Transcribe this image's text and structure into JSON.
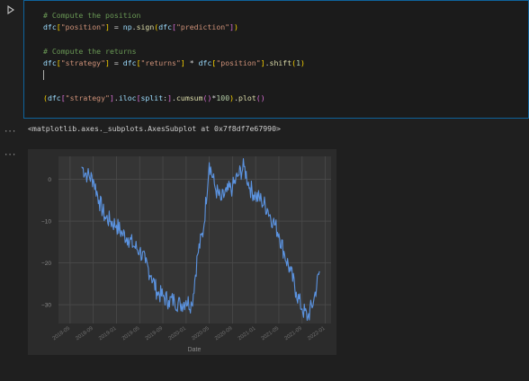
{
  "cell": {
    "code_lines": [
      [
        {
          "t": "# Compute the position",
          "c": "tok-comment"
        }
      ],
      [
        {
          "t": "dfc",
          "c": "tok-var"
        },
        {
          "t": "[",
          "c": "tok-br1"
        },
        {
          "t": "\"position\"",
          "c": "tok-str"
        },
        {
          "t": "]",
          "c": "tok-br1"
        },
        {
          "t": " = ",
          "c": "tok-op"
        },
        {
          "t": "np",
          "c": "tok-var"
        },
        {
          "t": ".",
          "c": "tok-op"
        },
        {
          "t": "sign",
          "c": "tok-fn"
        },
        {
          "t": "(",
          "c": "tok-br1"
        },
        {
          "t": "dfc",
          "c": "tok-var"
        },
        {
          "t": "[",
          "c": "tok-br2"
        },
        {
          "t": "\"prediction\"",
          "c": "tok-str"
        },
        {
          "t": "]",
          "c": "tok-br2"
        },
        {
          "t": ")",
          "c": "tok-br1"
        }
      ],
      [],
      [
        {
          "t": "# Compute the returns",
          "c": "tok-comment"
        }
      ],
      [
        {
          "t": "dfc",
          "c": "tok-var"
        },
        {
          "t": "[",
          "c": "tok-br1"
        },
        {
          "t": "\"strategy\"",
          "c": "tok-str"
        },
        {
          "t": "]",
          "c": "tok-br1"
        },
        {
          "t": " = ",
          "c": "tok-op"
        },
        {
          "t": "dfc",
          "c": "tok-var"
        },
        {
          "t": "[",
          "c": "tok-br1"
        },
        {
          "t": "\"returns\"",
          "c": "tok-str"
        },
        {
          "t": "]",
          "c": "tok-br1"
        },
        {
          "t": " * ",
          "c": "tok-op"
        },
        {
          "t": "dfc",
          "c": "tok-var"
        },
        {
          "t": "[",
          "c": "tok-br1"
        },
        {
          "t": "\"position\"",
          "c": "tok-str"
        },
        {
          "t": "]",
          "c": "tok-br1"
        },
        {
          "t": ".",
          "c": "tok-op"
        },
        {
          "t": "shift",
          "c": "tok-fn"
        },
        {
          "t": "(",
          "c": "tok-br1"
        },
        {
          "t": "1",
          "c": "tok-num"
        },
        {
          "t": ")",
          "c": "tok-br1"
        }
      ],
      [
        {
          "cursor": true
        }
      ],
      [],
      [
        {
          "t": "(",
          "c": "tok-br1"
        },
        {
          "t": "dfc",
          "c": "tok-var"
        },
        {
          "t": "[",
          "c": "tok-br2"
        },
        {
          "t": "\"strategy\"",
          "c": "tok-str"
        },
        {
          "t": "]",
          "c": "tok-br2"
        },
        {
          "t": ".",
          "c": "tok-op"
        },
        {
          "t": "iloc",
          "c": "tok-var"
        },
        {
          "t": "[",
          "c": "tok-br2"
        },
        {
          "t": "split",
          "c": "tok-var"
        },
        {
          "t": ":",
          "c": "tok-op"
        },
        {
          "t": "]",
          "c": "tok-br2"
        },
        {
          "t": ".",
          "c": "tok-op"
        },
        {
          "t": "cumsum",
          "c": "tok-fn"
        },
        {
          "t": "(",
          "c": "tok-br2"
        },
        {
          "t": ")",
          "c": "tok-br2"
        },
        {
          "t": "*",
          "c": "tok-op"
        },
        {
          "t": "100",
          "c": "tok-num"
        },
        {
          "t": ")",
          "c": "tok-br1"
        },
        {
          "t": ".",
          "c": "tok-op"
        },
        {
          "t": "plot",
          "c": "tok-fn"
        },
        {
          "t": "(",
          "c": "tok-br2"
        },
        {
          "t": ")",
          "c": "tok-br2"
        }
      ]
    ]
  },
  "output": {
    "menu_glyph": "···",
    "text_result": "<matplotlib.axes._subplots.AxesSubplot at 0x7f8df7e67990>"
  },
  "chart_data": {
    "type": "line",
    "title": "",
    "xlabel": "Date",
    "ylabel": "",
    "ylim": [
      -34.5,
      5.5
    ],
    "yticks": [
      0,
      -10,
      -20,
      -30
    ],
    "ytick_labels": [
      "0",
      "−10",
      "−20",
      "−30"
    ],
    "xticks": [
      "2018-05",
      "2018-09",
      "2019-01",
      "2019-05",
      "2019-09",
      "2020-01",
      "2020-05",
      "2020-09",
      "2021-01",
      "2021-05",
      "2021-09",
      "2022-01"
    ],
    "grid": true,
    "series": [
      {
        "color": "#5b93e0",
        "x": [
          "2018-07",
          "2018-08",
          "2018-09",
          "2018-10",
          "2018-11",
          "2018-12",
          "2019-01",
          "2019-02",
          "2019-03",
          "2019-04",
          "2019-05",
          "2019-06",
          "2019-07",
          "2019-08",
          "2019-09",
          "2019-10",
          "2019-11",
          "2019-12",
          "2020-01",
          "2020-02",
          "2020-03",
          "2020-04",
          "2020-05",
          "2020-06",
          "2020-07",
          "2020-08",
          "2020-09",
          "2020-10",
          "2020-11",
          "2020-12",
          "2021-01",
          "2021-02",
          "2021-03",
          "2021-04",
          "2021-05",
          "2021-06",
          "2021-07",
          "2021-08",
          "2021-09",
          "2021-10",
          "2021-11",
          "2021-12"
        ],
        "values": [
          3,
          1,
          0,
          -5,
          -9,
          -10,
          -11,
          -13,
          -14,
          -16,
          -17,
          -20,
          -23,
          -27,
          -28,
          -29,
          -29,
          -30,
          -29,
          -30,
          -18,
          -12,
          4,
          -2,
          -5,
          -3,
          -2,
          1,
          3,
          -2,
          -4,
          -5,
          -7,
          -10,
          -13,
          -18,
          -22,
          -27,
          -31,
          -33,
          -29,
          -22
        ]
      }
    ]
  }
}
